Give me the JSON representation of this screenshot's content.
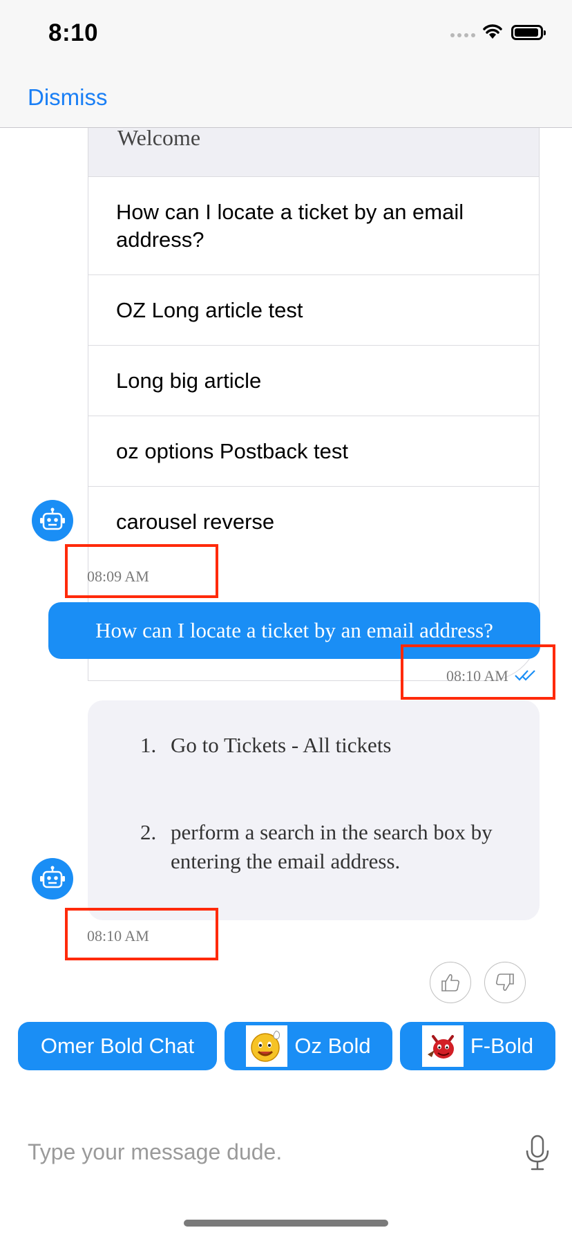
{
  "status_bar": {
    "time": "8:10"
  },
  "nav": {
    "dismiss_label": "Dismiss"
  },
  "menu_card": {
    "header": "Welcome",
    "items": [
      "How can I locate a ticket by an email address?",
      "OZ Long article test",
      "Long big article",
      "oz options Postback test",
      "carousel reverse"
    ],
    "timestamp": "08:09 AM"
  },
  "user_message": {
    "text": "How can I locate a ticket by an email address?",
    "timestamp": "08:10 AM"
  },
  "bot_answer": {
    "steps": [
      {
        "num": "1.",
        "text": "Go to Tickets - All tickets"
      },
      {
        "num": "2.",
        "text": "perform a search in the search box by entering the email address."
      }
    ],
    "timestamp": "08:10 AM"
  },
  "quick_replies": [
    {
      "label": "Omer Bold Chat",
      "icon": ""
    },
    {
      "label": "Oz Bold",
      "icon": "smiley-waving-icon"
    },
    {
      "label": "F-Bold",
      "icon": "red-devil-icon"
    }
  ],
  "composer": {
    "placeholder": "Type your message dude."
  },
  "colors": {
    "accent": "#1a8ef5",
    "link": "#1a7ff5",
    "highlight": "#ff2a0a",
    "bubble_gray": "#f2f2f7"
  }
}
